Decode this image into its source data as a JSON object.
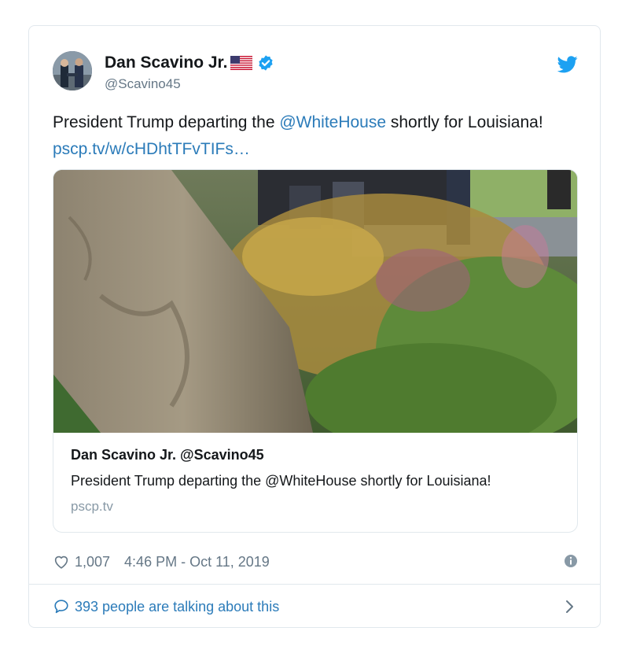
{
  "author": {
    "display_name": "Dan Scavino Jr.",
    "handle": "@Scavino45",
    "avatar_icon": "avatar-photo",
    "flag_icon": "us-flag-icon",
    "verified_icon": "verified-badge-icon"
  },
  "brand": {
    "icon": "twitter-bird-icon",
    "color": "#1da1f2"
  },
  "tweet": {
    "text_before": "President Trump departing the ",
    "mention": "@WhiteHouse",
    "text_after": " shortly for Louisiana! ",
    "link": "pscp.tv/w/cHDhtTFvTIFs…"
  },
  "card": {
    "image_icon": "video-preview",
    "title": "Dan Scavino Jr. @Scavino45",
    "description": "President Trump departing the @WhiteHouse shortly for Louisiana!",
    "domain": "pscp.tv"
  },
  "meta": {
    "like_count": "1,007",
    "timestamp": "4:46 PM - Oct 11, 2019",
    "info_icon": "info-icon"
  },
  "footer": {
    "talking_text": "393 people are talking about this"
  },
  "colors": {
    "link": "#2b7bb9",
    "muted": "#657786",
    "border": "#e1e8ed"
  }
}
